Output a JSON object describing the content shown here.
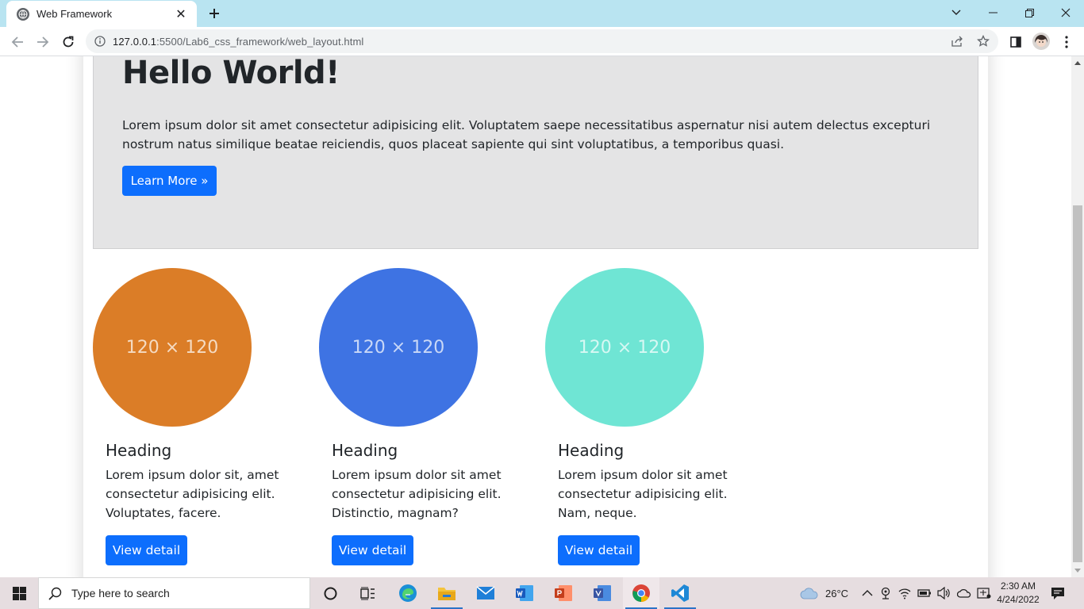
{
  "browser": {
    "tab_title": "Web Framework",
    "tab_close": "✕",
    "new_tab": "+",
    "url_host": "127.0.0.1",
    "url_path": ":5500/Lab6_css_framework/web_layout.html"
  },
  "page": {
    "hero_title": "Hello World!",
    "hero_text": "Lorem ipsum dolor sit amet consectetur adipisicing elit. Voluptatem saepe necessitatibus aspernatur nisi autem delectus excepturi nostrum natus similique beatae reiciendis, quos placeat sapiente qui sint voluptatibus, a temporibus quasi.",
    "hero_button": "Learn More »",
    "columns": [
      {
        "placeholder": "120 × 120",
        "color": "#db7d27",
        "heading": "Heading",
        "text": "Lorem ipsum dolor sit, amet consectetur adipisicing elit. Voluptates, facere.",
        "button": "View detail"
      },
      {
        "placeholder": "120 × 120",
        "color": "#3e73e3",
        "heading": "Heading",
        "text": "Lorem ipsum dolor sit amet consectetur adipisicing elit. Distinctio, magnam?",
        "button": "View detail"
      },
      {
        "placeholder": "120 × 120",
        "color": "#6fe5d4",
        "heading": "Heading",
        "text": "Lorem ipsum dolor sit amet consectetur adipisicing elit. Nam, neque.",
        "button": "View detail"
      }
    ]
  },
  "taskbar": {
    "search_placeholder": "Type here to search",
    "weather": "26°C",
    "time": "2:30 AM",
    "date": "4/24/2022"
  },
  "colors": {
    "tabstrip": "#b9e4f1",
    "primary_button": "#0d6efd",
    "jumbotron": "#e4e4e5"
  }
}
